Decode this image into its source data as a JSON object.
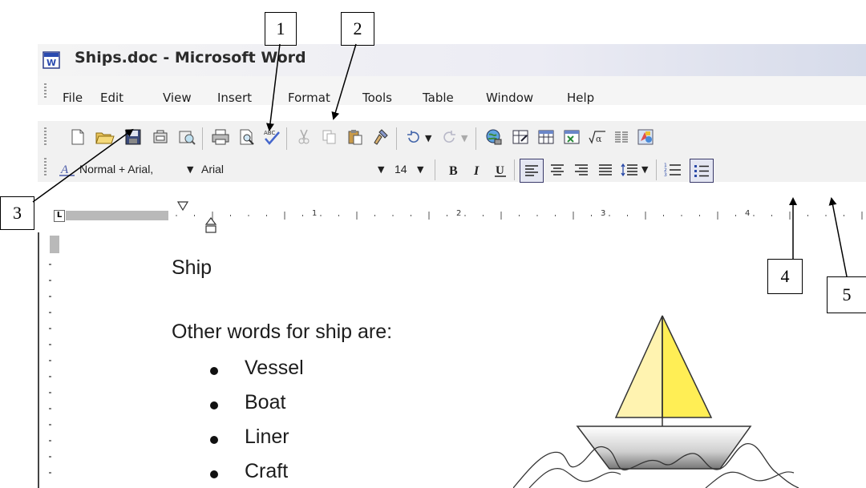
{
  "window": {
    "title": "Ships.doc - Microsoft Word"
  },
  "menu": [
    "File",
    "Edit",
    "View",
    "Insert",
    "Format",
    "Tools",
    "Table",
    "Window",
    "Help"
  ],
  "formatting": {
    "style": "Normal + Arial,",
    "font": "Arial",
    "size": "14"
  },
  "ruler": {
    "numbers": [
      "1",
      "2",
      "3",
      "4"
    ]
  },
  "document": {
    "heading": "Ship",
    "intro": "Other words for ship are:",
    "bullets": [
      "Vessel",
      "Boat",
      "Liner",
      "Craft"
    ]
  },
  "callouts": [
    "1",
    "2",
    "3",
    "4",
    "5"
  ],
  "colors": {
    "sail_left": "#fff3b0",
    "sail_right": "#ffee55",
    "title_text": "#2b2b2b"
  }
}
